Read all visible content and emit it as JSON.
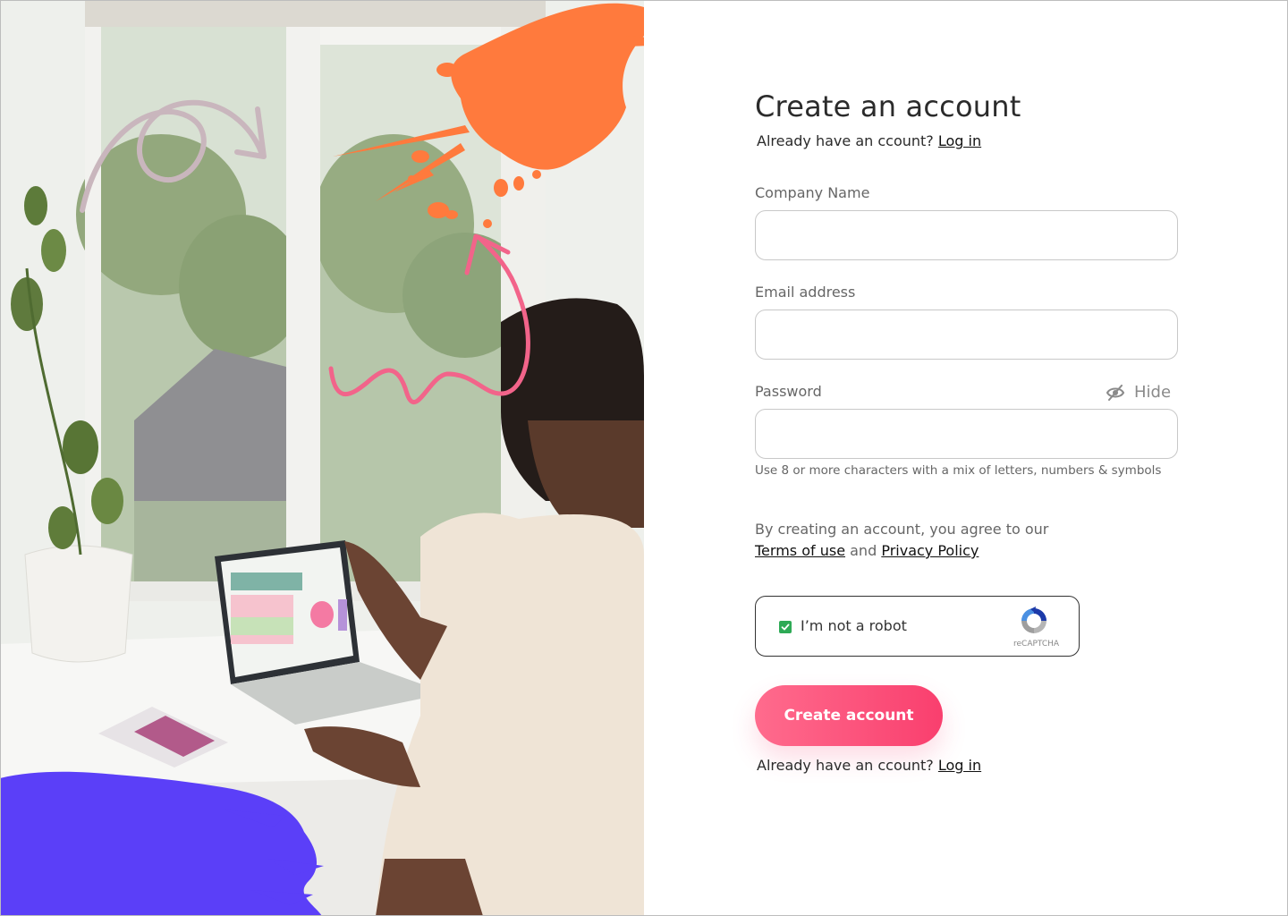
{
  "form": {
    "title": "Create an account",
    "login_prompt": "Already have an ccount?",
    "login_link": "Log in",
    "company_name_label": "Company Name",
    "company_name_value": "",
    "email_label": "Email address",
    "email_value": "",
    "password_label": "Password",
    "password_value": "",
    "hide_label": "Hide",
    "password_hint": "Use 8 or more characters with a mix of letters, numbers & symbols",
    "terms_prefix": "By creating an account, you agree to our",
    "terms_link": "Terms of use",
    "terms_and": "and",
    "privacy_link": "Privacy Policy",
    "captcha_label": "I’m not a robot",
    "captcha_brand": "reCAPTCHA",
    "captcha_checked": true,
    "submit_label": "Create account",
    "bottom_login_prompt": "Already have an ccount?",
    "bottom_login_link": "Log in"
  },
  "icons": {
    "hide": "eye-slash-icon",
    "captcha_check": "checkmark-icon",
    "captcha_logo": "recaptcha-logo-icon"
  },
  "colors": {
    "accent_pink": "#f93f6e",
    "accent_pink_light": "#ff6b8d",
    "splash_orange": "#ff7a3d",
    "splash_purple": "#5b3ff8",
    "captcha_green": "#2eaa56",
    "arrow_pink": "#f2648a",
    "arrow_mauve": "#c9b6bd"
  }
}
